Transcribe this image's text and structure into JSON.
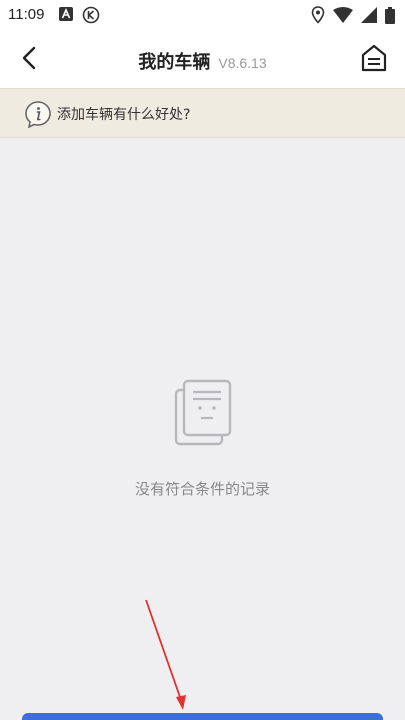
{
  "status_bar": {
    "time": "11:09",
    "left_icons": [
      "a-badge-icon",
      "k-circle-icon"
    ],
    "right_icons": [
      "location-icon",
      "wifi-icon",
      "signal-icon",
      "battery-icon"
    ]
  },
  "header": {
    "title": "我的车辆",
    "version": "V8.6.13"
  },
  "info_banner": {
    "text": "添加车辆有什么好处?"
  },
  "empty_state": {
    "message": "没有符合条件的记录"
  },
  "colors": {
    "background": "#efeff1",
    "banner": "#f0ebe0",
    "primary_button": "#3d6fd9",
    "annotation": "#e53030"
  }
}
